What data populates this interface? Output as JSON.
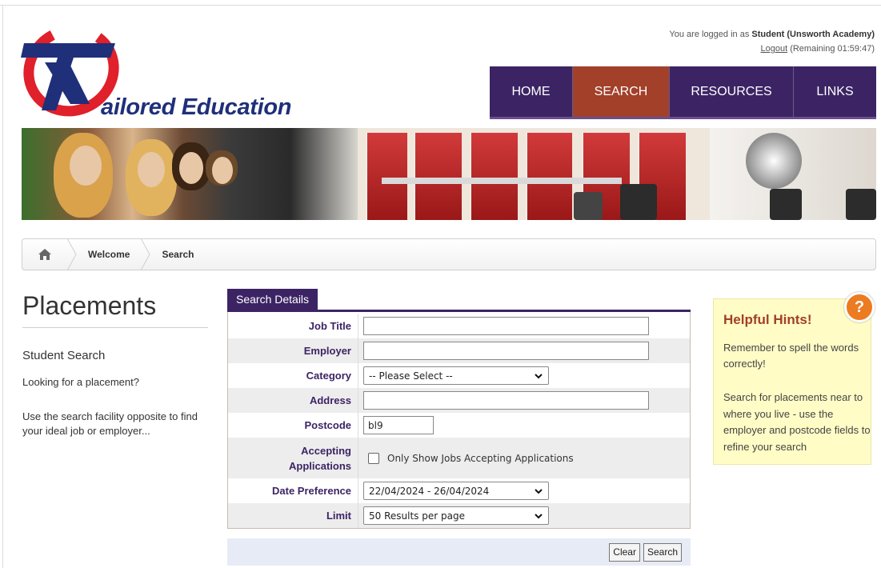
{
  "brand": {
    "logo_text": "ailored Education"
  },
  "login": {
    "prefix": "You are logged in as",
    "user": "Student (Unsworth Academy)",
    "logout": "Logout",
    "remaining": "(Remaining 01:59:47)"
  },
  "nav": {
    "items": [
      {
        "label": "HOME"
      },
      {
        "label": "SEARCH",
        "active": true
      },
      {
        "label": "RESOURCES"
      },
      {
        "label": "LINKS"
      }
    ]
  },
  "breadcrumb": {
    "items": [
      "Welcome",
      "Search"
    ]
  },
  "left": {
    "title": "Placements",
    "subtitle": "Student Search",
    "para1": "Looking for a placement?",
    "para2": "Use the search facility opposite to find your ideal job or employer..."
  },
  "form": {
    "tab": "Search Details",
    "job_title": {
      "label": "Job Title",
      "value": ""
    },
    "employer": {
      "label": "Employer",
      "value": ""
    },
    "category": {
      "label": "Category",
      "value": "-- Please Select --"
    },
    "address": {
      "label": "Address",
      "value": ""
    },
    "postcode": {
      "label": "Postcode",
      "value": "bl9"
    },
    "accepting": {
      "label_line1": "Accepting",
      "label_line2": "Applications",
      "checkbox_label": "Only Show Jobs Accepting Applications",
      "checked": false
    },
    "date_pref": {
      "label": "Date Preference",
      "value": "22/04/2024 - 26/04/2024"
    },
    "limit": {
      "label": "Limit",
      "value": "50 Results per page"
    }
  },
  "buttons": {
    "clear": "Clear",
    "search": "Search"
  },
  "hints": {
    "title": "Helpful Hints!",
    "p1": "Remember to spell the words correctly!",
    "p2": "Search for placements near to where you live - use the employer and postcode fields to refine your search",
    "badge": "?"
  },
  "colors": {
    "nav_bg": "#3c2464",
    "nav_active": "#a2402a",
    "logo_red": "#e0202a",
    "logo_blue": "#1f2f7a",
    "hint_bg": "#fffcc6",
    "badge": "#ec7b22"
  }
}
